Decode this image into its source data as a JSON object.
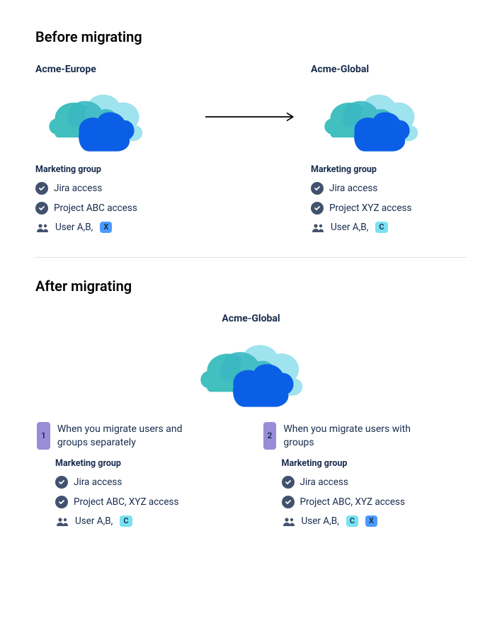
{
  "before": {
    "heading": "Before migrating",
    "left": {
      "title": "Acme-Europe",
      "group_label": "Marketing group",
      "perm1": "Jira access",
      "perm2": "Project ABC access",
      "users_prefix": "User A,B,",
      "badge1": "X"
    },
    "right": {
      "title": "Acme-Global",
      "group_label": "Marketing group",
      "perm1": "Jira access",
      "perm2": "Project XYZ access",
      "users_prefix": "User A,B,",
      "badge1": "C"
    }
  },
  "after": {
    "heading": "After migrating",
    "site_title": "Acme-Global",
    "option1": {
      "num": "1",
      "desc": "When you migrate users and groups separately",
      "group_label": "Marketing group",
      "perm1": "Jira access",
      "perm2": "Project ABC, XYZ access",
      "users_prefix": "User A,B,",
      "badge1": "C"
    },
    "option2": {
      "num": "2",
      "desc": "When you migrate users with groups",
      "group_label": "Marketing group",
      "perm1": "Jira access",
      "perm2": "Project ABC, XYZ access",
      "users_prefix": "User A,B,",
      "badge1": "C",
      "badge2": "X"
    }
  }
}
